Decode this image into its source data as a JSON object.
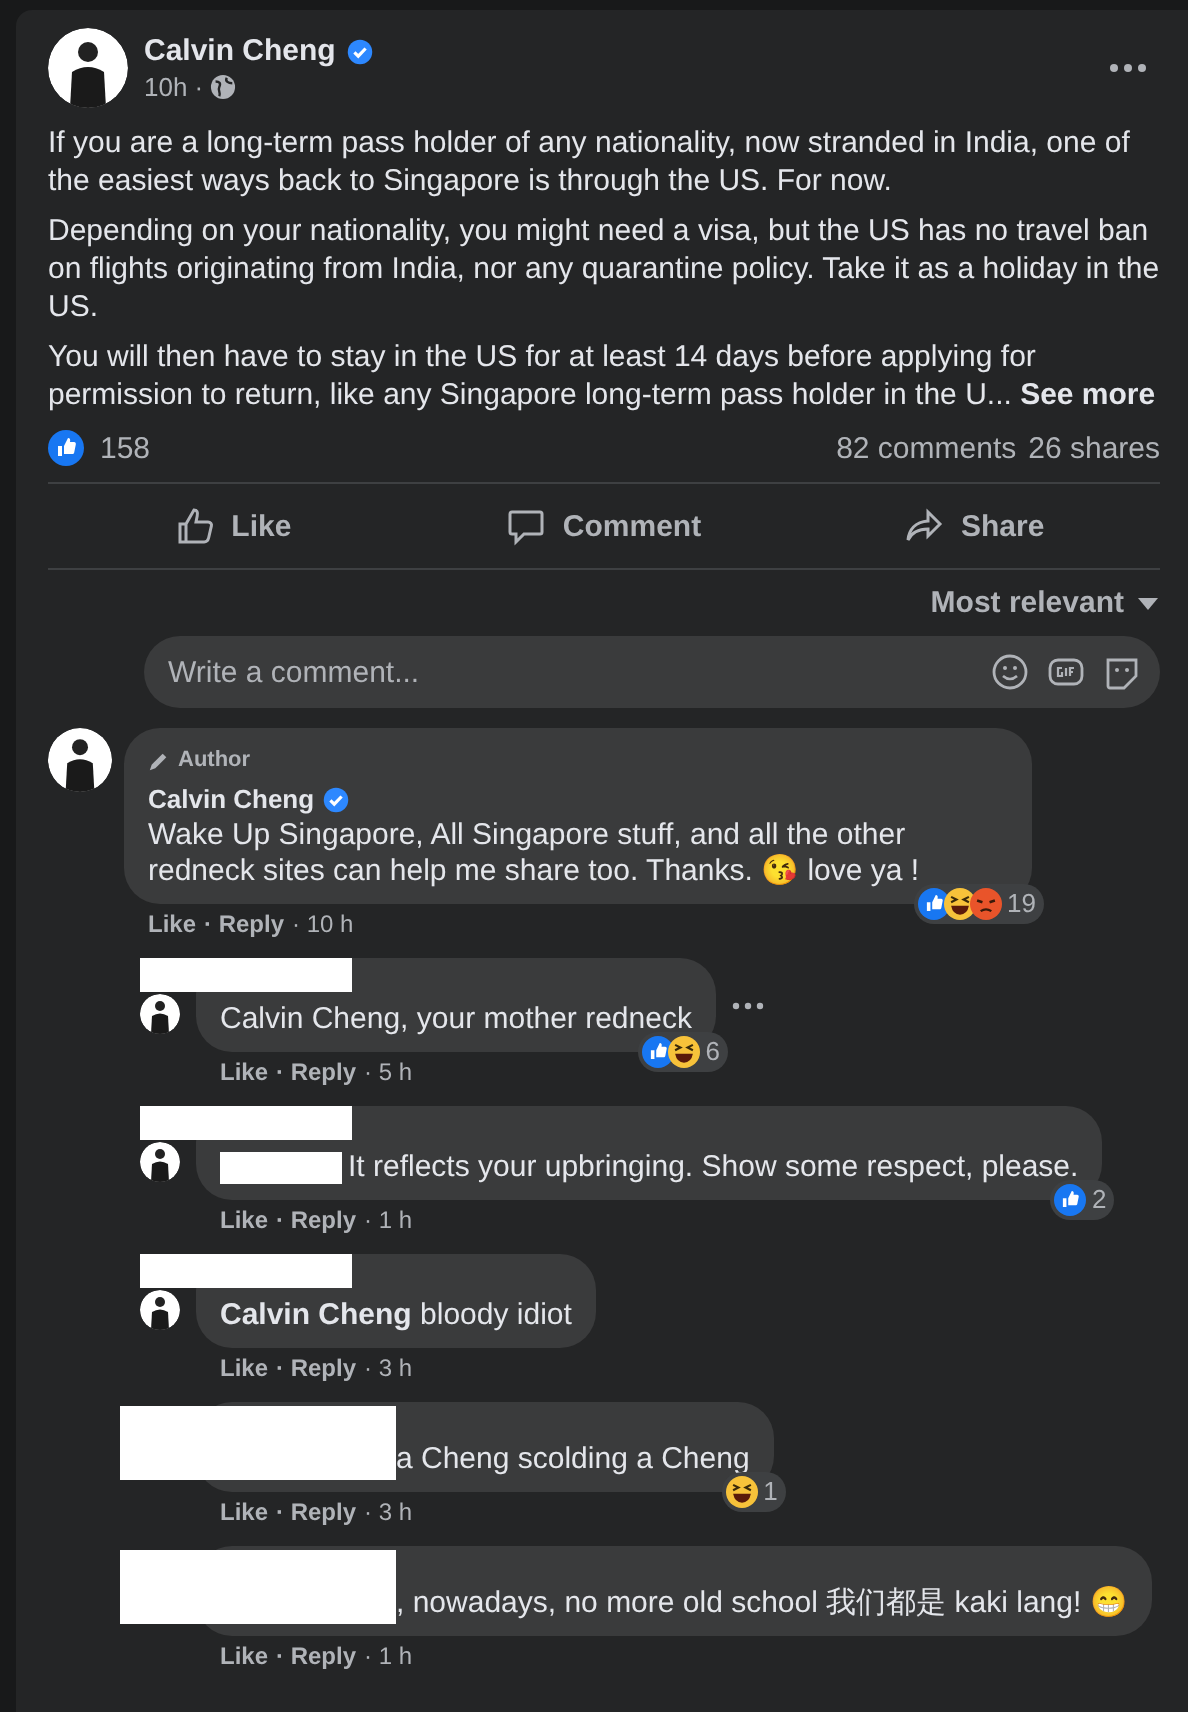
{
  "post": {
    "author": "Calvin Cheng",
    "verified": true,
    "time": "10h ·",
    "paragraphs": [
      "If you are a long-term pass holder of any nationality, now stranded in India, one of the easiest ways back to Singapore is through the US.  For now.",
      "Depending on your nationality, you might need a visa, but the US has no travel ban on flights originating from India, nor any quarantine policy.  Take it as a holiday in the US.",
      "You will then have to stay in the US for at least 14 days before applying for permission to return, like any Singapore long-term pass holder in the U..."
    ],
    "see_more": "See more",
    "reaction_count": "158",
    "comments_count": "82 comments",
    "shares_count": "26 shares",
    "actions": [
      {
        "kind": "like",
        "label": "Like"
      },
      {
        "kind": "comment",
        "label": "Comment"
      },
      {
        "kind": "share",
        "label": "Share"
      }
    ]
  },
  "sort": "Most relevant",
  "composer": {
    "placeholder": "Write a comment..."
  },
  "comments": [
    {
      "kind": "top",
      "badge": "Author",
      "name": "Calvin Cheng",
      "verified": true,
      "text": "Wake Up Singapore, All Singapore stuff, and all the other redneck sites can help me share too. Thanks. 😘 love ya !",
      "reactions": [
        {
          "kind": "like"
        },
        {
          "kind": "haha"
        },
        {
          "kind": "angry"
        }
      ],
      "reaction_count": "19",
      "like": "Like",
      "reply": "· Reply",
      "time": "· 10 h"
    },
    {
      "kind": "reply",
      "text": "Calvin Cheng, your mother redneck",
      "reactions": [
        {
          "kind": "like"
        },
        {
          "kind": "haha"
        }
      ],
      "reaction_count": "6",
      "like": "Like",
      "reply": "· Reply",
      "time": "· 5 h",
      "redactions": [
        {
          "kind": "name"
        }
      ],
      "more": true
    },
    {
      "kind": "reply",
      "text": "It reflects your upbringing. Show some respect, please.",
      "reactions": [
        {
          "kind": "like"
        }
      ],
      "reaction_count": "2",
      "like": "Like",
      "reply": "· Reply",
      "time": "· 1 h",
      "redactions": [
        {
          "kind": "name"
        },
        {
          "kind": "inline"
        }
      ]
    },
    {
      "kind": "reply",
      "text": "**Calvin Cheng** bloody idiot",
      "like": "Like",
      "reply": "· Reply",
      "time": "· 3 h",
      "redactions": [
        {
          "kind": "name"
        }
      ]
    },
    {
      "kind": "reply",
      "text": "a Cheng scolding a Cheng",
      "reactions": [
        {
          "kind": "haha"
        }
      ],
      "reaction_count": "1",
      "like": "Like",
      "reply": "· Reply",
      "time": "· 3 h",
      "redactions": [
        {
          "kind": "large"
        }
      ]
    },
    {
      "kind": "reply",
      "text": ", nowadays, no more old school 我们都是 kaki lang! 😁",
      "like": "Like",
      "reply": "· Reply",
      "time": "· 1 h",
      "redactions": [
        {
          "kind": "large"
        }
      ]
    }
  ]
}
